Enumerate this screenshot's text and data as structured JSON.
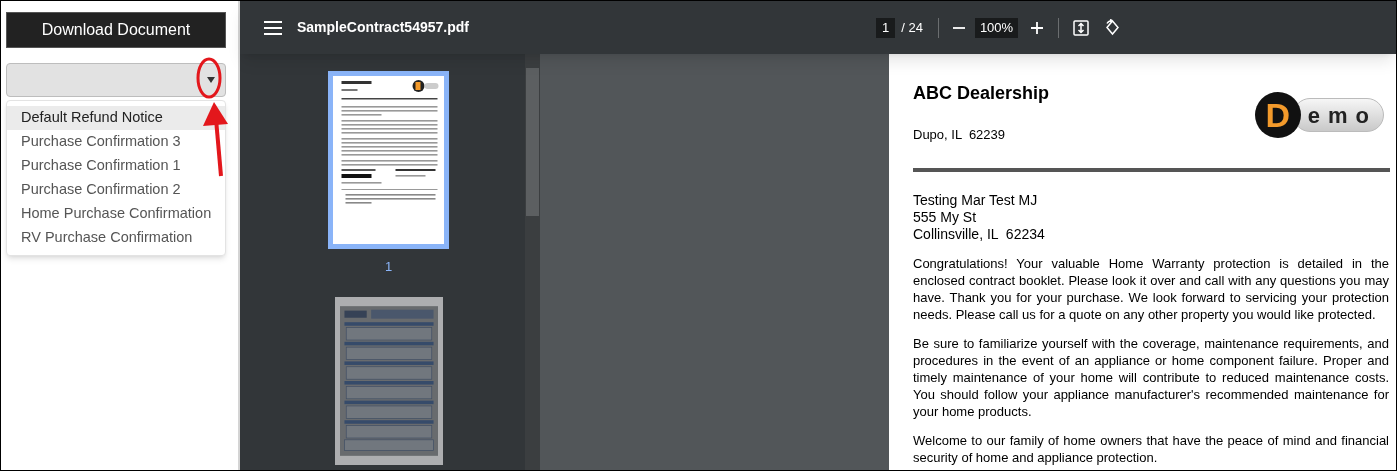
{
  "left_panel": {
    "download_button": "Download Document",
    "select": {
      "expanded": true
    },
    "options": [
      {
        "label": "Default Refund Notice",
        "selected": true
      },
      {
        "label": "Purchase Confirmation 3",
        "selected": false
      },
      {
        "label": "Purchase Confirmation 1",
        "selected": false
      },
      {
        "label": "Purchase Confirmation 2",
        "selected": false
      },
      {
        "label": "Home Purchase Confirmation",
        "selected": false
      },
      {
        "label": "RV Purchase Confirmation",
        "selected": false
      }
    ]
  },
  "viewer": {
    "title": "SampleContract54957.pdf",
    "page_input": "1",
    "page_total": "/ 24",
    "zoom": "100%",
    "thumbnails": [
      {
        "label": "1",
        "selected": true
      },
      {
        "selected": false
      }
    ],
    "document": {
      "dealer_name": "ABC Dealership",
      "dealer_address": "Dupo, IL  62239",
      "logo_initial": "D",
      "logo_rest": "emo",
      "recipient_lines": [
        "Testing Mar Test MJ",
        "555 My St",
        "Collinsville, IL  62234"
      ],
      "paragraphs": [
        {
          "lines": [
            "Congratulations!  Your valuable Home Warranty protection is detailed in the",
            "enclosed contract booklet.  Please look it over and call with any questions you may",
            "have.  Thank you for your purchase.  We look forward to servicing your protection",
            "needs.  Please call us for a quote on any other property you would like protected."
          ]
        },
        {
          "lines": [
            "Be sure to familiarize yourself with the coverage, maintenance requirements, and",
            "procedures in the event of an appliance or home component failure.   Proper and",
            "timely maintenance of your home will contribute to reduced maintenance costs.",
            "You should follow your appliance manufacturer's recommended maintenance for",
            "your home products."
          ]
        },
        {
          "lines": [
            "Welcome to our family of home owners that have the peace of mind and financial",
            "security of home and appliance protection."
          ]
        }
      ]
    }
  }
}
